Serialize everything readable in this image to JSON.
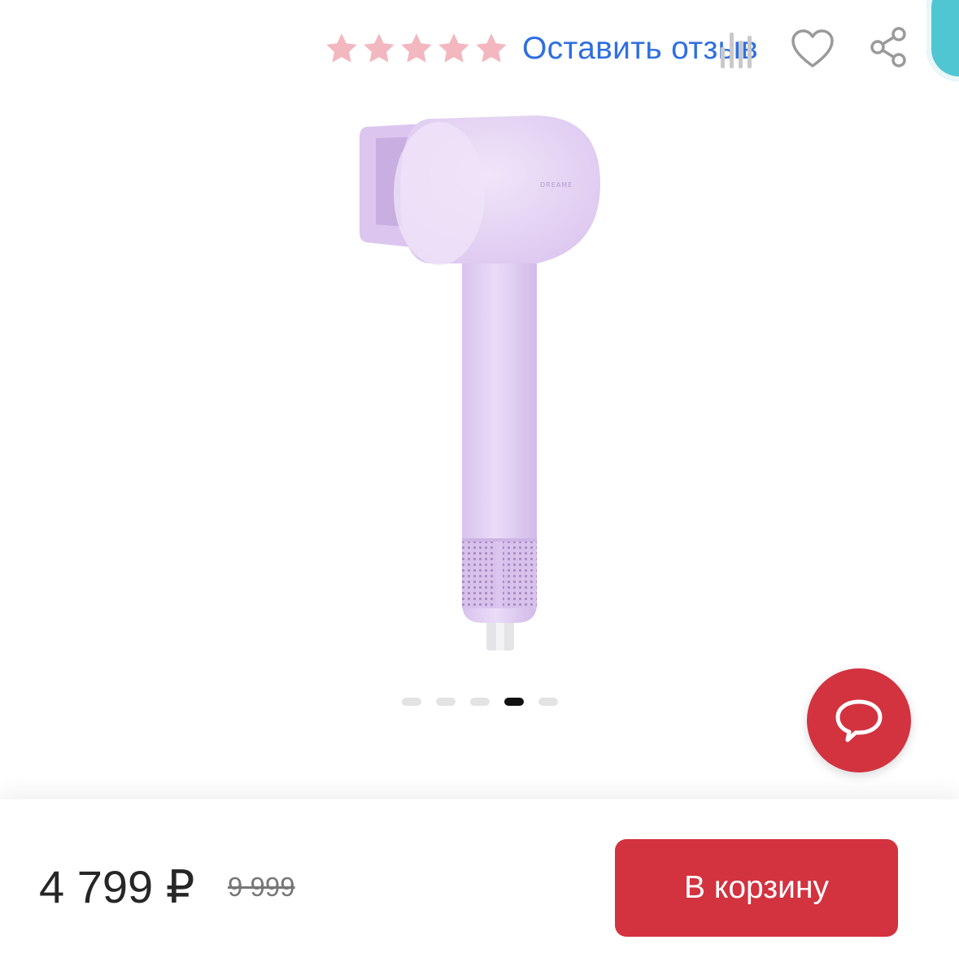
{
  "colors": {
    "accent_red": "#d3323f",
    "link_blue": "#2f6fe0",
    "star_pink": "#f3b7c0",
    "product_lilac": "#e2cdf1"
  },
  "rating": {
    "stars_filled": 5,
    "stars_total": 5,
    "review_link": "Оставить отзыв"
  },
  "icons": {
    "compare": "bar-chart-icon",
    "favorite": "heart-outline-icon",
    "share": "share-icon",
    "chat": "chat-bubble-icon"
  },
  "product": {
    "brand_mark": "DREAME"
  },
  "carousel": {
    "total": 5,
    "active_index": 3
  },
  "purchase": {
    "price": "4 799 ₽",
    "old_price": "9 999",
    "cart_button": "В корзину"
  }
}
